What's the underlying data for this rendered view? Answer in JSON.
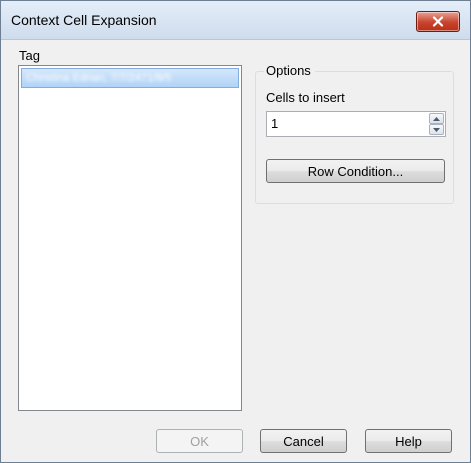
{
  "window": {
    "title": "Context Cell Expansion",
    "close_icon": "close-x-icon"
  },
  "tag": {
    "label": "Tag",
    "items": [
      {
        "text": "Christina Edrian, 7/7/2471/8/5",
        "selected": true
      }
    ]
  },
  "options": {
    "legend": "Options",
    "cells_label": "Cells to insert",
    "cells_value": "1",
    "row_condition_label": "Row Condition..."
  },
  "footer": {
    "ok_label": "OK",
    "ok_enabled": false,
    "cancel_label": "Cancel",
    "help_label": "Help"
  },
  "colors": {
    "dialog_bg": "#f0f0f0",
    "selection": "#b0d3f7",
    "close_button": "#c8442d"
  }
}
